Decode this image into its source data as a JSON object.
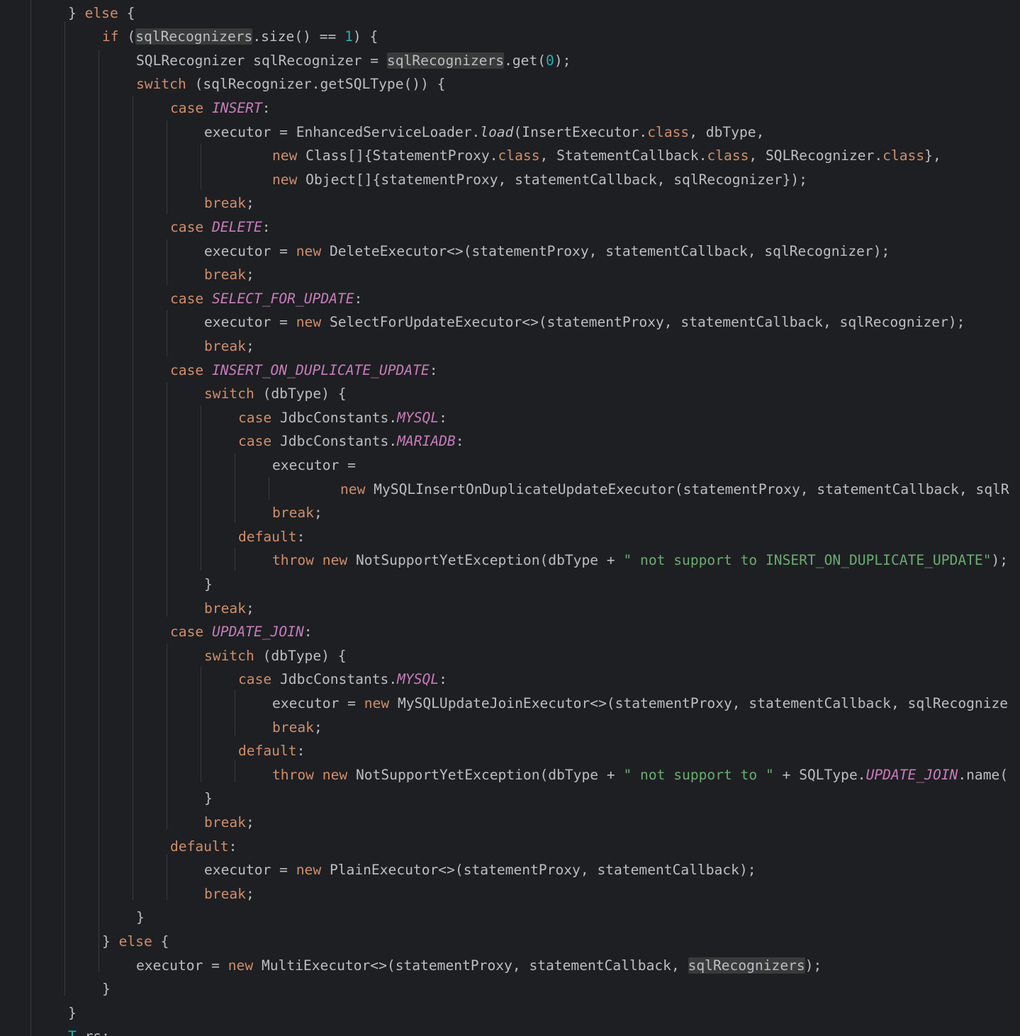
{
  "theme": {
    "background": "#1e1f22",
    "default_text": "#bcbec4",
    "keyword": "#cf8e6d",
    "constant": "#c77dbb",
    "number": "#2aacb8",
    "string": "#6aab73",
    "usage_highlight": "#373b39",
    "indent_guide": "#393b40"
  },
  "code_lines": [
    {
      "indent": 2,
      "tokens": [
        {
          "t": "} ",
          "k": "text"
        },
        {
          "t": "else",
          "k": "kw"
        },
        {
          "t": " {",
          "k": "text"
        }
      ]
    },
    {
      "indent": 3,
      "tokens": [
        {
          "t": "if",
          "k": "kw"
        },
        {
          "t": " (",
          "k": "text"
        },
        {
          "t": "sqlRecognizers",
          "k": "hl"
        },
        {
          "t": ".size() == ",
          "k": "text"
        },
        {
          "t": "1",
          "k": "num"
        },
        {
          "t": ") {",
          "k": "text"
        }
      ]
    },
    {
      "indent": 4,
      "tokens": [
        {
          "t": "SQLRecognizer sqlRecognizer = ",
          "k": "text"
        },
        {
          "t": "sqlRecognizers",
          "k": "hl"
        },
        {
          "t": ".get(",
          "k": "text"
        },
        {
          "t": "0",
          "k": "num"
        },
        {
          "t": ");",
          "k": "text"
        }
      ]
    },
    {
      "indent": 4,
      "tokens": [
        {
          "t": "switch",
          "k": "kw"
        },
        {
          "t": " (sqlRecognizer.getSQLType()) {",
          "k": "text"
        }
      ]
    },
    {
      "indent": 5,
      "tokens": [
        {
          "t": "case",
          "k": "kw"
        },
        {
          "t": " ",
          "k": "text"
        },
        {
          "t": "INSERT",
          "k": "const"
        },
        {
          "t": ":",
          "k": "text"
        }
      ]
    },
    {
      "indent": 6,
      "tokens": [
        {
          "t": "executor = EnhancedServiceLoader.",
          "k": "text"
        },
        {
          "t": "load",
          "k": "static-method"
        },
        {
          "t": "(InsertExecutor.",
          "k": "text"
        },
        {
          "t": "class",
          "k": "kw"
        },
        {
          "t": ", dbType,",
          "k": "text"
        }
      ]
    },
    {
      "indent": 8,
      "tokens": [
        {
          "t": "new",
          "k": "kw"
        },
        {
          "t": " Class[]{StatementProxy.",
          "k": "text"
        },
        {
          "t": "class",
          "k": "kw"
        },
        {
          "t": ", StatementCallback.",
          "k": "text"
        },
        {
          "t": "class",
          "k": "kw"
        },
        {
          "t": ", SQLRecognizer.",
          "k": "text"
        },
        {
          "t": "class",
          "k": "kw"
        },
        {
          "t": "},",
          "k": "text"
        }
      ]
    },
    {
      "indent": 8,
      "tokens": [
        {
          "t": "new",
          "k": "kw"
        },
        {
          "t": " Object[]{statementProxy, statementCallback, sqlRecognizer});",
          "k": "text"
        }
      ]
    },
    {
      "indent": 6,
      "tokens": [
        {
          "t": "break",
          "k": "kw"
        },
        {
          "t": ";",
          "k": "text"
        }
      ]
    },
    {
      "indent": 5,
      "tokens": [
        {
          "t": "case",
          "k": "kw"
        },
        {
          "t": " ",
          "k": "text"
        },
        {
          "t": "DELETE",
          "k": "const"
        },
        {
          "t": ":",
          "k": "text"
        }
      ]
    },
    {
      "indent": 6,
      "tokens": [
        {
          "t": "executor = ",
          "k": "text"
        },
        {
          "t": "new",
          "k": "kw"
        },
        {
          "t": " DeleteExecutor<>(statementProxy, statementCallback, sqlRecognizer);",
          "k": "text"
        }
      ]
    },
    {
      "indent": 6,
      "tokens": [
        {
          "t": "break",
          "k": "kw"
        },
        {
          "t": ";",
          "k": "text"
        }
      ]
    },
    {
      "indent": 5,
      "tokens": [
        {
          "t": "case",
          "k": "kw"
        },
        {
          "t": " ",
          "k": "text"
        },
        {
          "t": "SELECT_FOR_UPDATE",
          "k": "const"
        },
        {
          "t": ":",
          "k": "text"
        }
      ]
    },
    {
      "indent": 6,
      "tokens": [
        {
          "t": "executor = ",
          "k": "text"
        },
        {
          "t": "new",
          "k": "kw"
        },
        {
          "t": " SelectForUpdateExecutor<>(statementProxy, statementCallback, sqlRecognizer);",
          "k": "text"
        }
      ]
    },
    {
      "indent": 6,
      "tokens": [
        {
          "t": "break",
          "k": "kw"
        },
        {
          "t": ";",
          "k": "text"
        }
      ]
    },
    {
      "indent": 5,
      "tokens": [
        {
          "t": "case",
          "k": "kw"
        },
        {
          "t": " ",
          "k": "text"
        },
        {
          "t": "INSERT_ON_DUPLICATE_UPDATE",
          "k": "const"
        },
        {
          "t": ":",
          "k": "text"
        }
      ]
    },
    {
      "indent": 6,
      "tokens": [
        {
          "t": "switch",
          "k": "kw"
        },
        {
          "t": " (dbType) {",
          "k": "text"
        }
      ]
    },
    {
      "indent": 7,
      "tokens": [
        {
          "t": "case",
          "k": "kw"
        },
        {
          "t": " JdbcConstants.",
          "k": "text"
        },
        {
          "t": "MYSQL",
          "k": "const"
        },
        {
          "t": ":",
          "k": "text"
        }
      ]
    },
    {
      "indent": 7,
      "tokens": [
        {
          "t": "case",
          "k": "kw"
        },
        {
          "t": " JdbcConstants.",
          "k": "text"
        },
        {
          "t": "MARIADB",
          "k": "const"
        },
        {
          "t": ":",
          "k": "text"
        }
      ]
    },
    {
      "indent": 8,
      "tokens": [
        {
          "t": "executor =",
          "k": "text"
        }
      ]
    },
    {
      "indent": 10,
      "tokens": [
        {
          "t": "new",
          "k": "kw"
        },
        {
          "t": " MySQLInsertOnDuplicateUpdateExecutor(statementProxy, statementCallback, sqlR",
          "k": "text"
        }
      ]
    },
    {
      "indent": 8,
      "tokens": [
        {
          "t": "break",
          "k": "kw"
        },
        {
          "t": ";",
          "k": "text"
        }
      ]
    },
    {
      "indent": 7,
      "tokens": [
        {
          "t": "default",
          "k": "kw"
        },
        {
          "t": ":",
          "k": "text"
        }
      ]
    },
    {
      "indent": 8,
      "tokens": [
        {
          "t": "throw",
          "k": "kw"
        },
        {
          "t": " ",
          "k": "text"
        },
        {
          "t": "new",
          "k": "kw"
        },
        {
          "t": " NotSupportYetException(dbType + ",
          "k": "text"
        },
        {
          "t": "\" not support to INSERT_ON_DUPLICATE_UPDATE\"",
          "k": "str"
        },
        {
          "t": ");",
          "k": "text"
        }
      ]
    },
    {
      "indent": 6,
      "tokens": [
        {
          "t": "}",
          "k": "text"
        }
      ]
    },
    {
      "indent": 6,
      "tokens": [
        {
          "t": "break",
          "k": "kw"
        },
        {
          "t": ";",
          "k": "text"
        }
      ]
    },
    {
      "indent": 5,
      "tokens": [
        {
          "t": "case",
          "k": "kw"
        },
        {
          "t": " ",
          "k": "text"
        },
        {
          "t": "UPDATE_JOIN",
          "k": "const"
        },
        {
          "t": ":",
          "k": "text"
        }
      ]
    },
    {
      "indent": 6,
      "tokens": [
        {
          "t": "switch",
          "k": "kw"
        },
        {
          "t": " (dbType) {",
          "k": "text"
        }
      ]
    },
    {
      "indent": 7,
      "tokens": [
        {
          "t": "case",
          "k": "kw"
        },
        {
          "t": " JdbcConstants.",
          "k": "text"
        },
        {
          "t": "MYSQL",
          "k": "const"
        },
        {
          "t": ":",
          "k": "text"
        }
      ]
    },
    {
      "indent": 8,
      "tokens": [
        {
          "t": "executor = ",
          "k": "text"
        },
        {
          "t": "new",
          "k": "kw"
        },
        {
          "t": " MySQLUpdateJoinExecutor<>(statementProxy, statementCallback, sqlRecognize",
          "k": "text"
        }
      ]
    },
    {
      "indent": 8,
      "tokens": [
        {
          "t": "break",
          "k": "kw"
        },
        {
          "t": ";",
          "k": "text"
        }
      ]
    },
    {
      "indent": 7,
      "tokens": [
        {
          "t": "default",
          "k": "kw"
        },
        {
          "t": ":",
          "k": "text"
        }
      ]
    },
    {
      "indent": 8,
      "tokens": [
        {
          "t": "throw",
          "k": "kw"
        },
        {
          "t": " ",
          "k": "text"
        },
        {
          "t": "new",
          "k": "kw"
        },
        {
          "t": " NotSupportYetException(dbType + ",
          "k": "text"
        },
        {
          "t": "\" not support to \"",
          "k": "str"
        },
        {
          "t": " + SQLType.",
          "k": "text"
        },
        {
          "t": "UPDATE_JOIN",
          "k": "const"
        },
        {
          "t": ".name(",
          "k": "text"
        }
      ]
    },
    {
      "indent": 6,
      "tokens": [
        {
          "t": "}",
          "k": "text"
        }
      ]
    },
    {
      "indent": 6,
      "tokens": [
        {
          "t": "break",
          "k": "kw"
        },
        {
          "t": ";",
          "k": "text"
        }
      ]
    },
    {
      "indent": 5,
      "tokens": [
        {
          "t": "default",
          "k": "kw"
        },
        {
          "t": ":",
          "k": "text"
        }
      ]
    },
    {
      "indent": 6,
      "tokens": [
        {
          "t": "executor = ",
          "k": "text"
        },
        {
          "t": "new",
          "k": "kw"
        },
        {
          "t": " PlainExecutor<>(statementProxy, statementCallback);",
          "k": "text"
        }
      ]
    },
    {
      "indent": 6,
      "tokens": [
        {
          "t": "break",
          "k": "kw"
        },
        {
          "t": ";",
          "k": "text"
        }
      ]
    },
    {
      "indent": 4,
      "tokens": [
        {
          "t": "}",
          "k": "text"
        }
      ]
    },
    {
      "indent": 3,
      "tokens": [
        {
          "t": "} ",
          "k": "text"
        },
        {
          "t": "else",
          "k": "kw"
        },
        {
          "t": " {",
          "k": "text"
        }
      ]
    },
    {
      "indent": 4,
      "tokens": [
        {
          "t": "executor = ",
          "k": "text"
        },
        {
          "t": "new",
          "k": "kw"
        },
        {
          "t": " MultiExecutor<>(statementProxy, statementCallback, ",
          "k": "text"
        },
        {
          "t": "sqlRecognizers",
          "k": "hl"
        },
        {
          "t": ");",
          "k": "text"
        }
      ]
    },
    {
      "indent": 3,
      "tokens": [
        {
          "t": "}",
          "k": "text"
        }
      ]
    },
    {
      "indent": 2,
      "tokens": [
        {
          "t": "}",
          "k": "text"
        }
      ]
    },
    {
      "indent": 2,
      "tokens": [
        {
          "t": "T",
          "k": "type"
        },
        {
          "t": " rs;",
          "k": "text"
        }
      ]
    }
  ]
}
